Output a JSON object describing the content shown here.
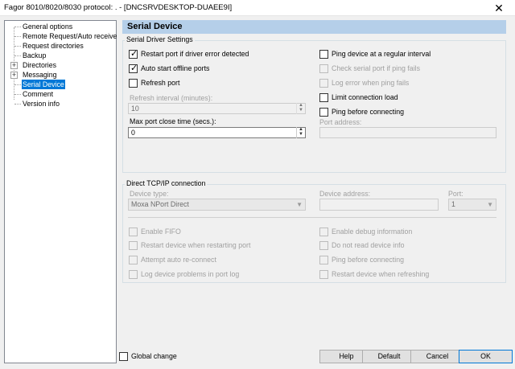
{
  "window": {
    "title": "Fagor 8010/8020/8030 protocol: . - [DNCSRVDESKTOP-DUAEE9I]",
    "close_glyph": "✕"
  },
  "tree": {
    "items": [
      {
        "label": "General options"
      },
      {
        "label": "Remote Request/Auto receive"
      },
      {
        "label": "Request directories"
      },
      {
        "label": "Backup"
      },
      {
        "label": "Directories",
        "expander": "+"
      },
      {
        "label": "Messaging",
        "expander": "+"
      },
      {
        "label": "Serial Device",
        "selected": true
      },
      {
        "label": "Comment"
      },
      {
        "label": "Version info"
      }
    ]
  },
  "page": {
    "header": "Serial Device"
  },
  "serial": {
    "group_title": "Serial Driver Settings",
    "restart_port": {
      "label": "Restart port if driver error detected",
      "checked": true
    },
    "auto_start": {
      "label": "Auto start offline ports",
      "checked": true
    },
    "refresh_port": {
      "label": "Refresh port",
      "checked": false
    },
    "refresh_interval_label": "Refresh interval (minutes):",
    "refresh_interval_value": "10",
    "max_close_label": "Max port close time (secs.):",
    "max_close_value": "0",
    "ping_regular": {
      "label": "Ping device at a regular interval",
      "checked": false
    },
    "check_serial": {
      "label": "Check serial port if ping fails",
      "checked": false
    },
    "log_error": {
      "label": "Log error when ping fails",
      "checked": false
    },
    "limit_load": {
      "label": "Limit connection load",
      "checked": false
    },
    "ping_before": {
      "label": "Ping before connecting",
      "checked": false
    },
    "port_address_label": "Port address:",
    "port_address_value": ""
  },
  "tcp": {
    "group_title": "Direct TCP/IP connection",
    "device_type_label": "Device type:",
    "device_type_value": "Moxa NPort Direct",
    "device_address_label": "Device address:",
    "device_address_value": "",
    "port_label": "Port:",
    "port_value": "1",
    "enable_fifo": "Enable FIFO",
    "restart_device": "Restart device when restarting port",
    "attempt_reconnect": "Attempt auto re-connect",
    "log_problems": "Log device problems in port log",
    "enable_debug": "Enable debug information",
    "no_read_info": "Do not read device info",
    "ping_before": "Ping before connecting",
    "restart_refresh": "Restart device when refreshing"
  },
  "footer": {
    "global_change": "Global change",
    "help": "Help",
    "default": "Default",
    "cancel": "Cancel",
    "ok": "OK"
  }
}
